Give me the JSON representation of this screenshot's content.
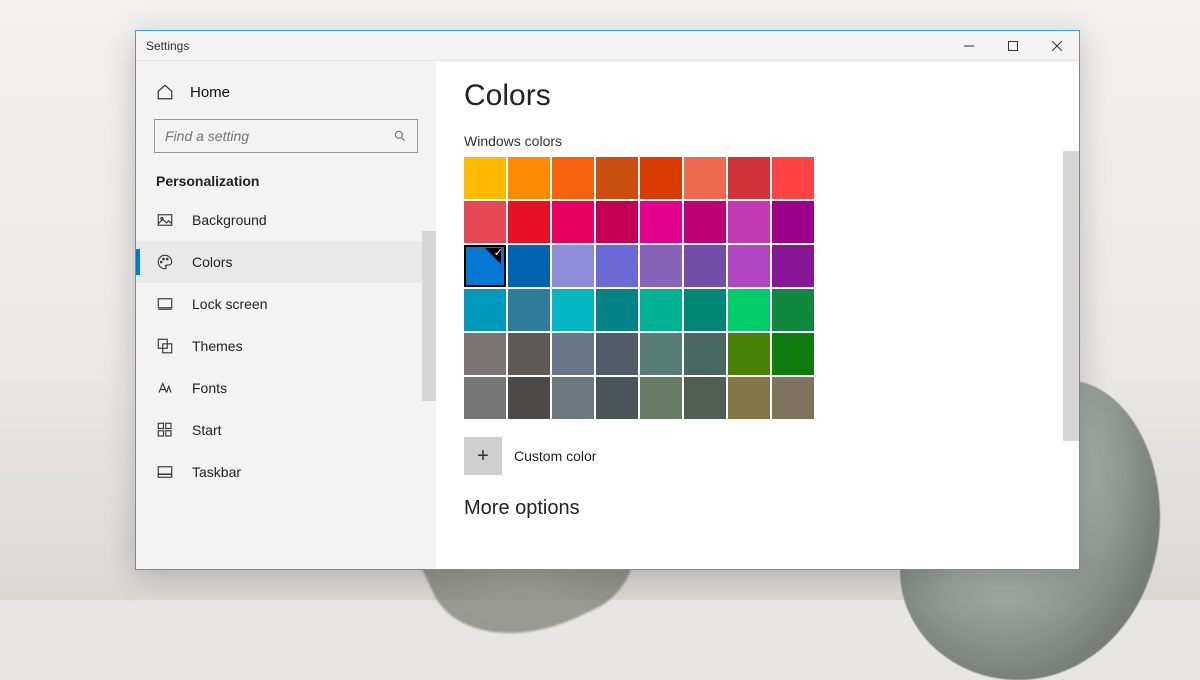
{
  "window": {
    "title": "Settings"
  },
  "sidebar": {
    "home_label": "Home",
    "search_placeholder": "Find a setting",
    "section_header": "Personalization",
    "items": [
      {
        "label": "Background",
        "icon": "picture"
      },
      {
        "label": "Colors",
        "icon": "palette",
        "active": true
      },
      {
        "label": "Lock screen",
        "icon": "lock-screen"
      },
      {
        "label": "Themes",
        "icon": "themes"
      },
      {
        "label": "Fonts",
        "icon": "fonts"
      },
      {
        "label": "Start",
        "icon": "start"
      },
      {
        "label": "Taskbar",
        "icon": "taskbar"
      }
    ]
  },
  "content": {
    "heading": "Colors",
    "swatch_header": "Windows colors",
    "custom_color_label": "Custom color",
    "more_options_label": "More options",
    "selected_index": 16,
    "colors": [
      "#ffb900",
      "#ff8c00",
      "#f7630c",
      "#ca5010",
      "#da3b01",
      "#ef6950",
      "#d13438",
      "#ff4343",
      "#e74856",
      "#e81123",
      "#ea005e",
      "#c30052",
      "#e3008c",
      "#bf0077",
      "#c239b3",
      "#9a0089",
      "#0078d4",
      "#0063b1",
      "#8e8cd8",
      "#6b69d6",
      "#8764b8",
      "#744da9",
      "#b146c2",
      "#881798",
      "#0099bc",
      "#2d7d9a",
      "#00b7c3",
      "#038387",
      "#00b294",
      "#018574",
      "#00cc6a",
      "#10893e",
      "#7a7574",
      "#5d5a58",
      "#68768a",
      "#515c6b",
      "#567c73",
      "#486860",
      "#498205",
      "#107c10",
      "#767676",
      "#4c4a48",
      "#69797e",
      "#4a5459",
      "#647c64",
      "#525e54",
      "#847545",
      "#7e735f"
    ]
  }
}
